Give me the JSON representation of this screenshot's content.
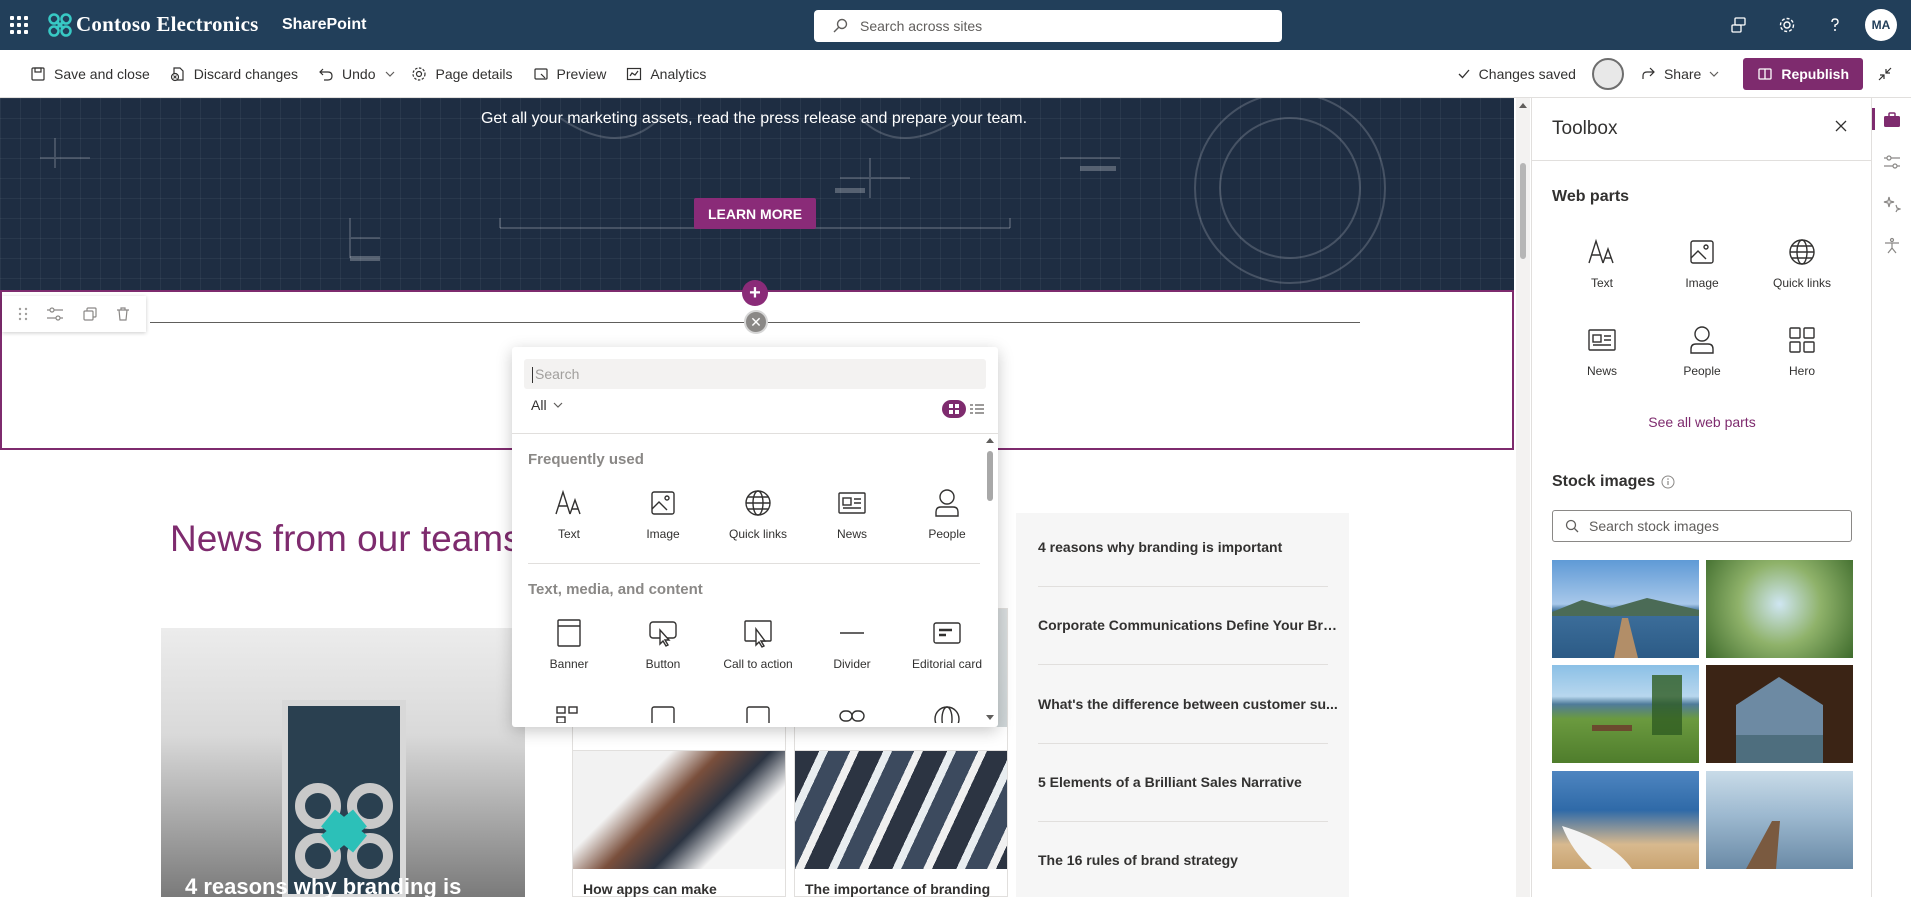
{
  "suite": {
    "brand": "Contoso Electronics",
    "app": "SharePoint",
    "search_placeholder": "Search across sites",
    "avatar_initials": "MA"
  },
  "commands": {
    "save_close": "Save and close",
    "discard": "Discard changes",
    "undo": "Undo",
    "page_details": "Page details",
    "preview": "Preview",
    "analytics": "Analytics",
    "status": "Changes saved",
    "share": "Share",
    "republish": "Republish"
  },
  "hero": {
    "text": "Get all your marketing assets, read the press release and prepare your team.",
    "button": "LEARN MORE"
  },
  "news": {
    "title": "News from our teams",
    "hero_caption": "4 reasons why branding is",
    "cards": [
      "How apps can make",
      "The importance of branding"
    ],
    "list": [
      "4 reasons why branding is important",
      "Corporate Communications Define Your Bra...",
      "What's the difference between customer su...",
      "5 Elements of a Brilliant Sales Narrative",
      "The 16 rules of brand strategy"
    ]
  },
  "picker": {
    "search_placeholder": "Search",
    "filter": "All",
    "groups": [
      {
        "title": "Frequently used",
        "items": [
          {
            "label": "Text",
            "icon": "text-icon"
          },
          {
            "label": "Image",
            "icon": "image-icon"
          },
          {
            "label": "Quick links",
            "icon": "globe-icon"
          },
          {
            "label": "News",
            "icon": "news-icon"
          },
          {
            "label": "People",
            "icon": "person-icon"
          }
        ]
      },
      {
        "title": "Text, media, and content",
        "items": [
          {
            "label": "Banner",
            "icon": "banner-icon"
          },
          {
            "label": "Button",
            "icon": "button-icon"
          },
          {
            "label": "Call to action",
            "icon": "call-to-action-icon"
          },
          {
            "label": "Divider",
            "icon": "divider-icon"
          },
          {
            "label": "Editorial card",
            "icon": "editorial-card-icon"
          }
        ]
      }
    ]
  },
  "toolbox": {
    "title": "Toolbox",
    "web_parts_heading": "Web parts",
    "web_parts": [
      {
        "label": "Text",
        "icon": "text-icon"
      },
      {
        "label": "Image",
        "icon": "image-icon"
      },
      {
        "label": "Quick links",
        "icon": "globe-icon"
      },
      {
        "label": "News",
        "icon": "news-icon"
      },
      {
        "label": "People",
        "icon": "person-icon"
      },
      {
        "label": "Hero",
        "icon": "hero-icon"
      }
    ],
    "see_all": "See all web parts",
    "stock_heading": "Stock images",
    "stock_search_placeholder": "Search stock images"
  },
  "colors": {
    "suite": "#223f5a",
    "accent": "#7e2b6e"
  }
}
